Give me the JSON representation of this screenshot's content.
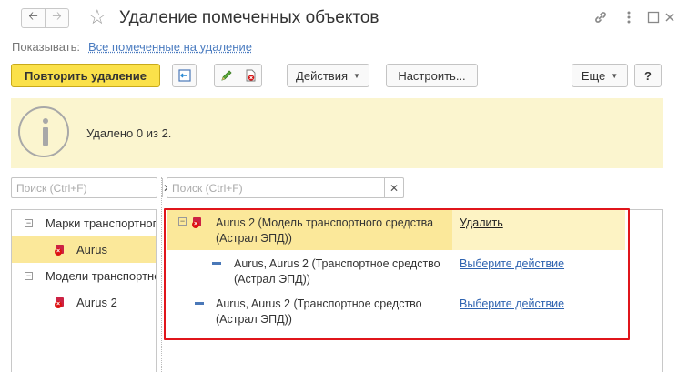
{
  "window": {
    "title": "Удаление помеченных объектов"
  },
  "filter": {
    "label": "Показывать:",
    "value": "Все помеченные на удаление"
  },
  "toolbar": {
    "retry_label": "Повторить удаление",
    "actions_label": "Действия",
    "configure_label": "Настроить...",
    "more_label": "Еще",
    "help_label": "?"
  },
  "info": {
    "message": "Удалено 0 из 2."
  },
  "left_search": {
    "placeholder": "Поиск (Ctrl+F)"
  },
  "right_search": {
    "placeholder": "Поиск (Ctrl+F)"
  },
  "tree": {
    "items": [
      {
        "label": "Марки транспортного",
        "type": "group",
        "icon": "minus-toggle-icon"
      },
      {
        "label": "Aurus",
        "type": "item",
        "icon": "deleted-object-icon",
        "selected": true
      },
      {
        "label": "Модели транспортног",
        "type": "group",
        "icon": "minus-toggle-icon"
      },
      {
        "label": "Aurus 2",
        "type": "item",
        "icon": "deleted-object-icon"
      }
    ]
  },
  "grid": {
    "rows": [
      {
        "name": "Aurus 2 (Модель транспортного средства (Астрал ЭПД))",
        "action": "Удалить",
        "icon": "deleted-object-icon"
      },
      {
        "name": "Aurus, Aurus 2 (Транспортное средство (Астрал ЭПД))",
        "action": "Выберите действие",
        "icon": "dash-icon"
      },
      {
        "name": "Aurus, Aurus 2 (Транспортное средство (Астрал ЭПД))",
        "action": "Выберите действие",
        "icon": "dash-icon"
      }
    ]
  },
  "colors": {
    "primary_button": "#fbe14a",
    "info_background": "#fbf5cf",
    "selected_row": "#fbe89a",
    "highlight_border": "#e0151b",
    "link": "#2e63b0"
  }
}
